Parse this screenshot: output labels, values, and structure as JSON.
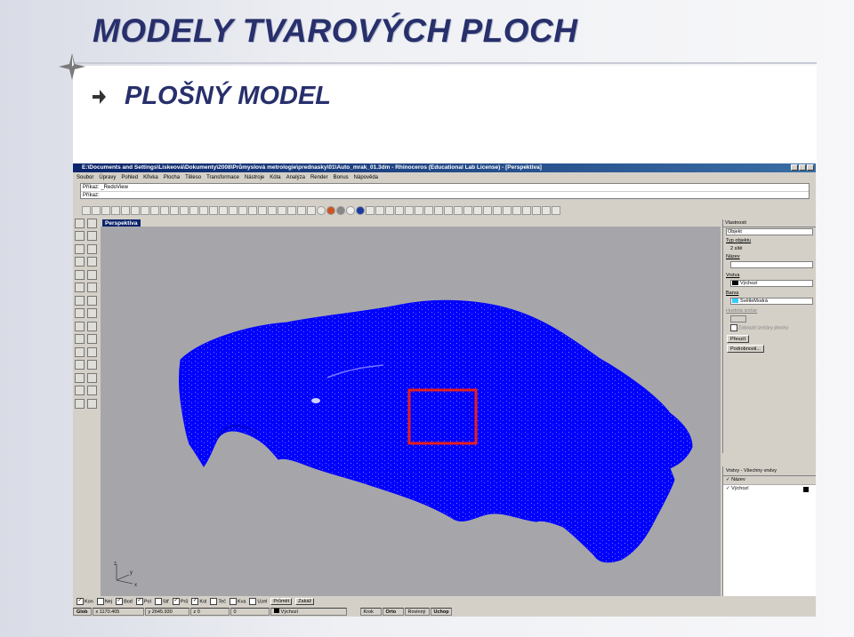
{
  "slide": {
    "title": "MODELY TVAROVÝCH PLOCH",
    "subtitle": "PLOŠNÝ MODEL"
  },
  "app": {
    "window_title": "E:\\Documents and Settings\\Liskeová\\Dokumenty\\2008\\Průmyslová metrologie\\prednasky\\01\\Auto_mrak_01.3dm - Rhinoceros (Educational Lab License) - [Perspektiva]",
    "menu": [
      "Soubor",
      "Úpravy",
      "Pohled",
      "Křivka",
      "Plocha",
      "Těleso",
      "Transformace",
      "Nástroje",
      "Kóta",
      "Analýza",
      "Render",
      "Bonus",
      "Nápověda"
    ],
    "command_history": "Příkaz: _RedoView",
    "command_prompt": "Příkaz:",
    "viewport_label": "Perspektiva",
    "axis_labels": {
      "x": "x",
      "y": "y",
      "z": "z"
    }
  },
  "properties": {
    "panel_title": "Vlastnosti",
    "dropdown_value": "Objekt",
    "type_label": "Typ objektu",
    "type_value": "2 sítě",
    "name_label": "Název",
    "layer_label": "Vrstva",
    "layer_value": "Výchozí",
    "color_label": "Barva",
    "color_value": "SvětleModrá",
    "isocurves_label": "Hustota izočar",
    "isocurves_check_label": "Zobrazit izočáry plochy",
    "match_button": "Převzít",
    "details_button": "Podrobnosti..."
  },
  "layers": {
    "panel_title": "Vrstvy - Všechny vrstvy",
    "header": "Název",
    "rows": [
      "Výchozí"
    ]
  },
  "osnap": {
    "items": [
      {
        "label": "Kon",
        "checked": true
      },
      {
        "label": "Nej",
        "checked": false
      },
      {
        "label": "Bod",
        "checked": true
      },
      {
        "label": "Pol",
        "checked": true
      },
      {
        "label": "Stř",
        "checked": false
      },
      {
        "label": "Prů",
        "checked": true
      },
      {
        "label": "Kol",
        "checked": true
      },
      {
        "label": "Teč",
        "checked": false
      },
      {
        "label": "Kva",
        "checked": false
      },
      {
        "label": "Uzel",
        "checked": false
      }
    ],
    "project_button": "Průmět",
    "disable_button": "Zakáž"
  },
  "status": {
    "mode": "Glob",
    "x": "x 1170.405",
    "y": "y 2645.930",
    "z": "z 0",
    "dist": "0",
    "layer": "Výchozí",
    "snap": "Krok",
    "ortho": "Orto",
    "planar": "Rovinný",
    "osnap": "Uchop"
  },
  "colors": {
    "car": "#0000ff",
    "highlight": "#e8201a",
    "titlebar": "#0a246a",
    "title_text": "#27306b",
    "viewport_bg": "#a6a6aa"
  }
}
